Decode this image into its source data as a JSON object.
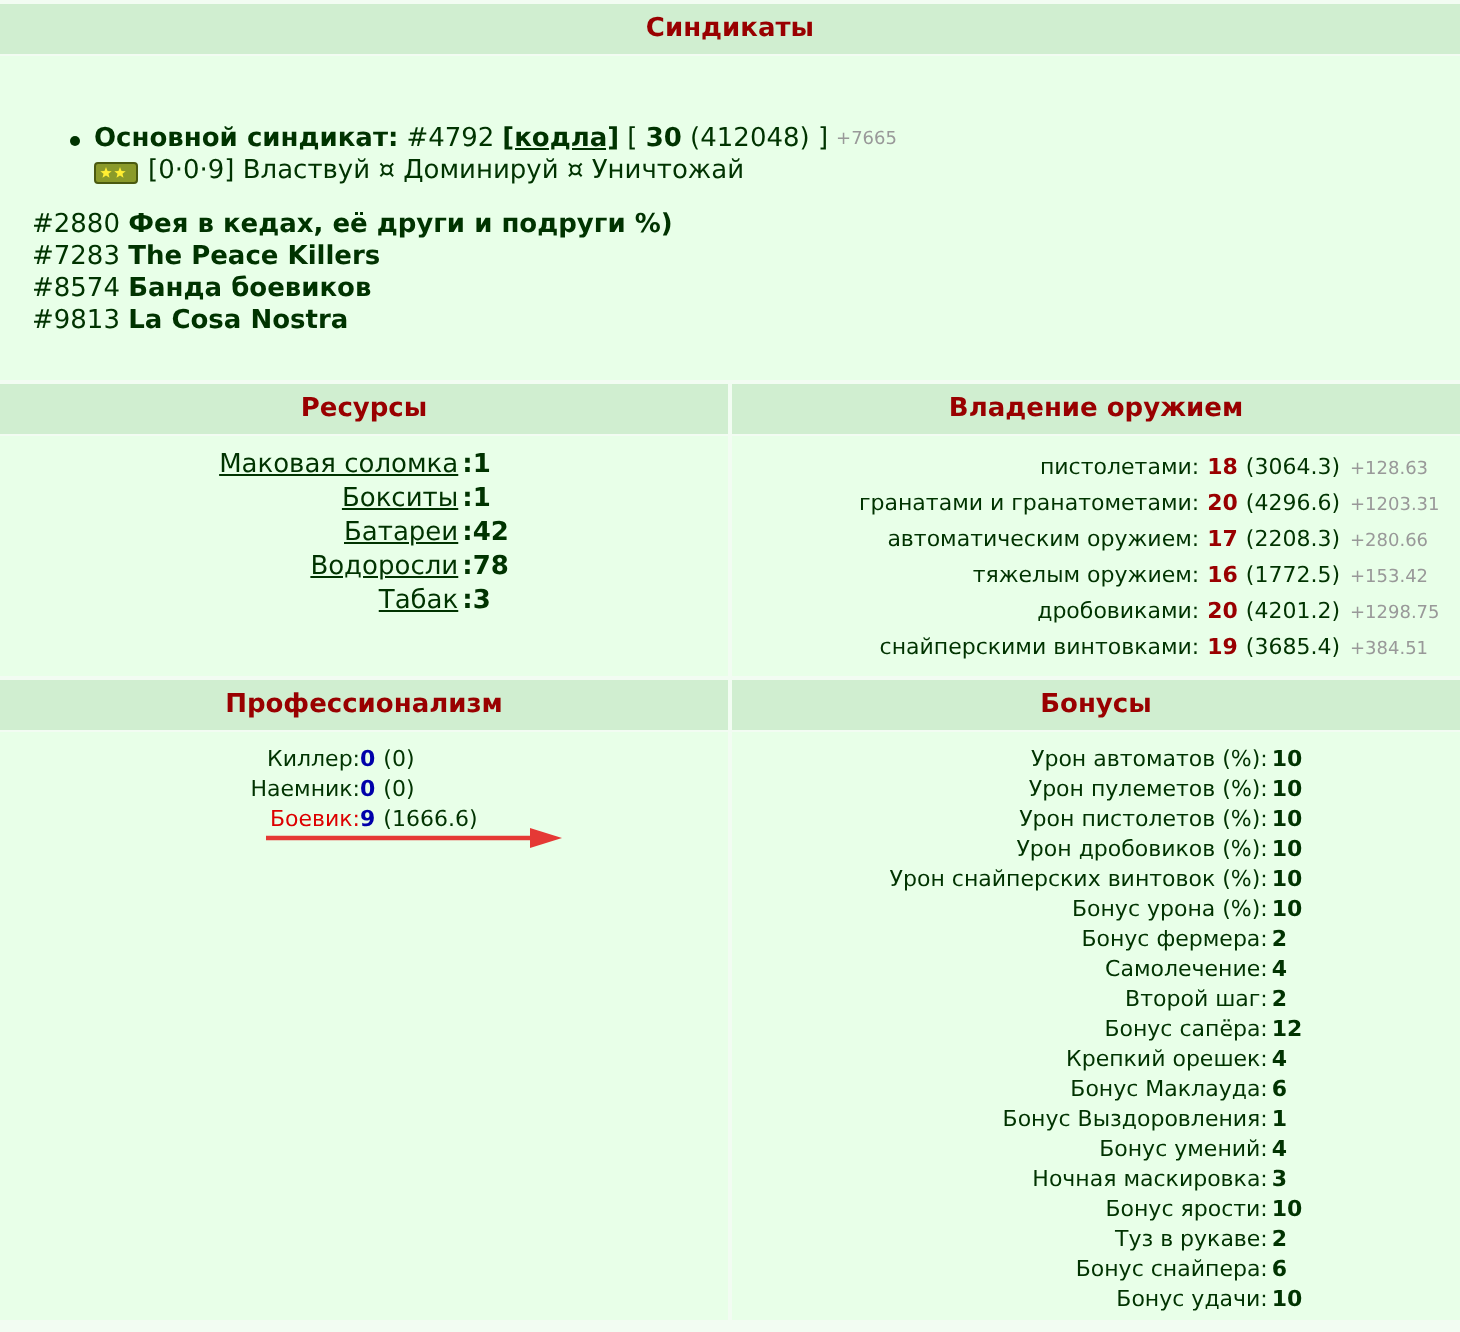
{
  "syndicates": {
    "title": "Синдикаты",
    "main": {
      "label": "Основной синдикат:",
      "id": "#4792",
      "link": "[кодла]",
      "level": "[ **30** (412048) ]",
      "gain": "+7665",
      "motto": "[0·0·9] Властвуй ¤ Доминируй ¤ Уничтожай"
    },
    "others": [
      "#2880 **Фея в кедах, её други и подруги %)**",
      "#7283 **The Peace Killers**",
      "#8574 **Банда боевиков**",
      "#9813 **La Cosa Nostra**"
    ]
  },
  "resources": {
    "title": "Ресурсы",
    "items": [
      {
        "name": "Маковая соломка",
        "value": ":1"
      },
      {
        "name": "Бокситы",
        "value": ":1"
      },
      {
        "name": "Батареи",
        "value": ":42"
      },
      {
        "name": "Водоросли",
        "value": ":78"
      },
      {
        "name": "Табак",
        "value": ":3"
      }
    ]
  },
  "weapons": {
    "title": "Владение оружием",
    "items": [
      {
        "name": "пистолетами:",
        "level": "18",
        "points": "(3064.3)",
        "gain": "+128.63"
      },
      {
        "name": "гранатами и гранатометами:",
        "level": "20",
        "points": "(4296.6)",
        "gain": "+1203.31"
      },
      {
        "name": "автоматическим оружием:",
        "level": "17",
        "points": "(2208.3)",
        "gain": "+280.66"
      },
      {
        "name": "тяжелым оружием:",
        "level": "16",
        "points": "(1772.5)",
        "gain": "+153.42"
      },
      {
        "name": "дробовиками:",
        "level": "20",
        "points": "(4201.2)",
        "gain": "+1298.75"
      },
      {
        "name": "снайперскими винтовками:",
        "level": "19",
        "points": "(3685.4)",
        "gain": "+384.51"
      }
    ]
  },
  "professions": {
    "title": "Профессионализм",
    "items": [
      {
        "name": "Киллер:",
        "level": "0",
        "points": "(0)",
        "current": false
      },
      {
        "name": "Наемник:",
        "level": "0",
        "points": "(0)",
        "current": false
      },
      {
        "name": "Боевик:",
        "level": "9",
        "points": "(1666.6)",
        "current": true
      }
    ]
  },
  "bonuses": {
    "title": "Бонусы",
    "items": [
      {
        "name": "Урон автоматов (%):",
        "value": "10"
      },
      {
        "name": "Урон пулеметов (%):",
        "value": "10"
      },
      {
        "name": "Урон пистолетов (%):",
        "value": "10"
      },
      {
        "name": "Урон дробовиков (%):",
        "value": "10"
      },
      {
        "name": "Урон снайперских винтовок (%):",
        "value": "10"
      },
      {
        "name": "Бонус урона (%):",
        "value": "10"
      },
      {
        "name": "Бонус фермера:",
        "value": "2"
      },
      {
        "name": "Самолечение:",
        "value": "4"
      },
      {
        "name": "Второй шаг:",
        "value": "2"
      },
      {
        "name": "Бонус сапёра:",
        "value": "12"
      },
      {
        "name": "Крепкий орешек:",
        "value": "4"
      },
      {
        "name": "Бонус Маклауда:",
        "value": "6"
      },
      {
        "name": "Бонус Выздоровления:",
        "value": "1"
      },
      {
        "name": "Бонус умений:",
        "value": "4"
      },
      {
        "name": "Ночная маскировка:",
        "value": "3"
      },
      {
        "name": "Бонус ярости:",
        "value": "10"
      },
      {
        "name": "Туз в рукаве:",
        "value": "2"
      },
      {
        "name": "Бонус снайпера:",
        "value": "6"
      },
      {
        "name": "Бонус удачи:",
        "value": "10"
      }
    ]
  }
}
